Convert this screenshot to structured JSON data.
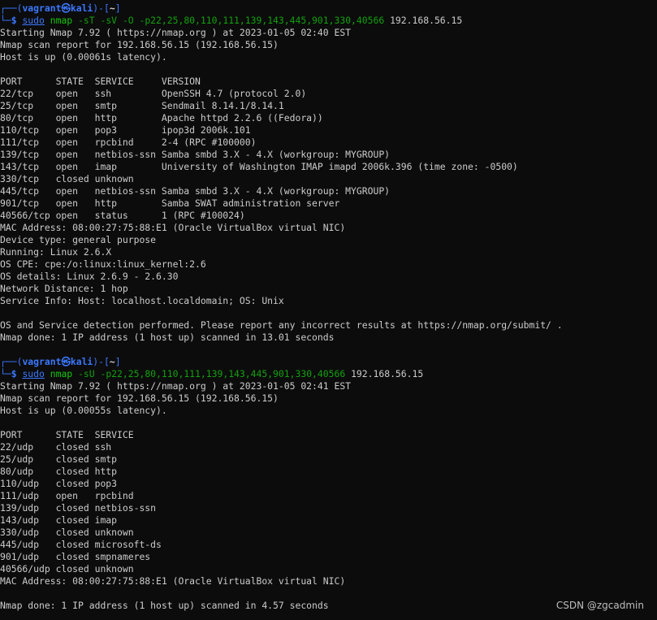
{
  "terminal": {
    "prompt": {
      "user": "vagrant",
      "separator": "㉿",
      "host": "kali",
      "cwd": "~",
      "dollar": "$"
    },
    "sessions": [
      {
        "command": {
          "sudo": "sudo",
          "program": "nmap",
          "args": "-sT -sV -O -p22,25,80,110,111,139,143,445,901,330,40566",
          "target": "192.168.56.15"
        },
        "output": [
          "Starting Nmap 7.92 ( https://nmap.org ) at 2023-01-05 02:40 EST",
          "Nmap scan report for 192.168.56.15 (192.168.56.15)",
          "Host is up (0.00061s latency).",
          "",
          "PORT      STATE  SERVICE     VERSION",
          "22/tcp    open   ssh         OpenSSH 4.7 (protocol 2.0)",
          "25/tcp    open   smtp        Sendmail 8.14.1/8.14.1",
          "80/tcp    open   http        Apache httpd 2.2.6 ((Fedora))",
          "110/tcp   open   pop3        ipop3d 2006k.101",
          "111/tcp   open   rpcbind     2-4 (RPC #100000)",
          "139/tcp   open   netbios-ssn Samba smbd 3.X - 4.X (workgroup: MYGROUP)",
          "143/tcp   open   imap        University of Washington IMAP imapd 2006k.396 (time zone: -0500)",
          "330/tcp   closed unknown",
          "445/tcp   open   netbios-ssn Samba smbd 3.X - 4.X (workgroup: MYGROUP)",
          "901/tcp   open   http        Samba SWAT administration server",
          "40566/tcp open   status      1 (RPC #100024)",
          "MAC Address: 08:00:27:75:88:E1 (Oracle VirtualBox virtual NIC)",
          "Device type: general purpose",
          "Running: Linux 2.6.X",
          "OS CPE: cpe:/o:linux:linux_kernel:2.6",
          "OS details: Linux 2.6.9 - 2.6.30",
          "Network Distance: 1 hop",
          "Service Info: Host: localhost.localdomain; OS: Unix",
          "",
          "OS and Service detection performed. Please report any incorrect results at https://nmap.org/submit/ .",
          "Nmap done: 1 IP address (1 host up) scanned in 13.01 seconds",
          ""
        ]
      },
      {
        "command": {
          "sudo": "sudo",
          "program": "nmap",
          "args": "-sU -p22,25,80,110,111,139,143,445,901,330,40566",
          "target": "192.168.56.15"
        },
        "output": [
          "Starting Nmap 7.92 ( https://nmap.org ) at 2023-01-05 02:41 EST",
          "Nmap scan report for 192.168.56.15 (192.168.56.15)",
          "Host is up (0.00055s latency).",
          "",
          "PORT      STATE  SERVICE",
          "22/udp    closed ssh",
          "25/udp    closed smtp",
          "80/udp    closed http",
          "110/udp   closed pop3",
          "111/udp   open   rpcbind",
          "139/udp   closed netbios-ssn",
          "143/udp   closed imap",
          "330/udp   closed unknown",
          "445/udp   closed microsoft-ds",
          "901/udp   closed smpnameres",
          "40566/udp closed unknown",
          "MAC Address: 08:00:27:75:88:E1 (Oracle VirtualBox virtual NIC)",
          "",
          "Nmap done: 1 IP address (1 host up) scanned in 4.57 seconds"
        ]
      }
    ]
  },
  "watermark": "CSDN @zgcadmin",
  "colors": {
    "background": "#0c0c0c",
    "text": "#cccccc",
    "prompt_frame": "#3b78ff",
    "command": "#16c60c",
    "args": "#13a10e"
  }
}
